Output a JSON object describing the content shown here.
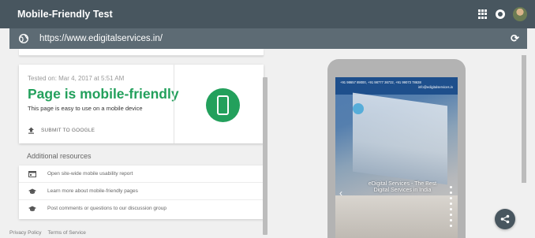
{
  "topbar": {
    "title": "Mobile-Friendly Test"
  },
  "urlbar": {
    "url": "https://www.edigitalservices.in/"
  },
  "result": {
    "tested_on": "Tested on: Mar 4, 2017 at 5:51 AM",
    "headline": "Page is mobile-friendly",
    "subtext": "This page is easy to use on a mobile device",
    "submit_label": "SUBMIT TO GOOGLE",
    "status_color": "#23a05c"
  },
  "resources": {
    "title": "Additional resources",
    "items": [
      {
        "icon": "report-icon",
        "label": "Open site-wide mobile usability report"
      },
      {
        "icon": "school-icon",
        "label": "Learn more about mobile-friendly pages"
      },
      {
        "icon": "school-icon",
        "label": "Post comments or questions to our discussion group"
      }
    ]
  },
  "footer": {
    "privacy": "Privacy Policy",
    "terms": "Terms of Service"
  },
  "preview": {
    "top_text": "+91 98657 89000, +91 98777 36722, +91 99073 78638",
    "email": "info@edigitalservices.in",
    "caption": "eDigital Services - The Best Digital Services in India"
  },
  "colors": {
    "header": "#48565f",
    "urlbar": "#5d6b74",
    "accent": "#23a05c"
  }
}
